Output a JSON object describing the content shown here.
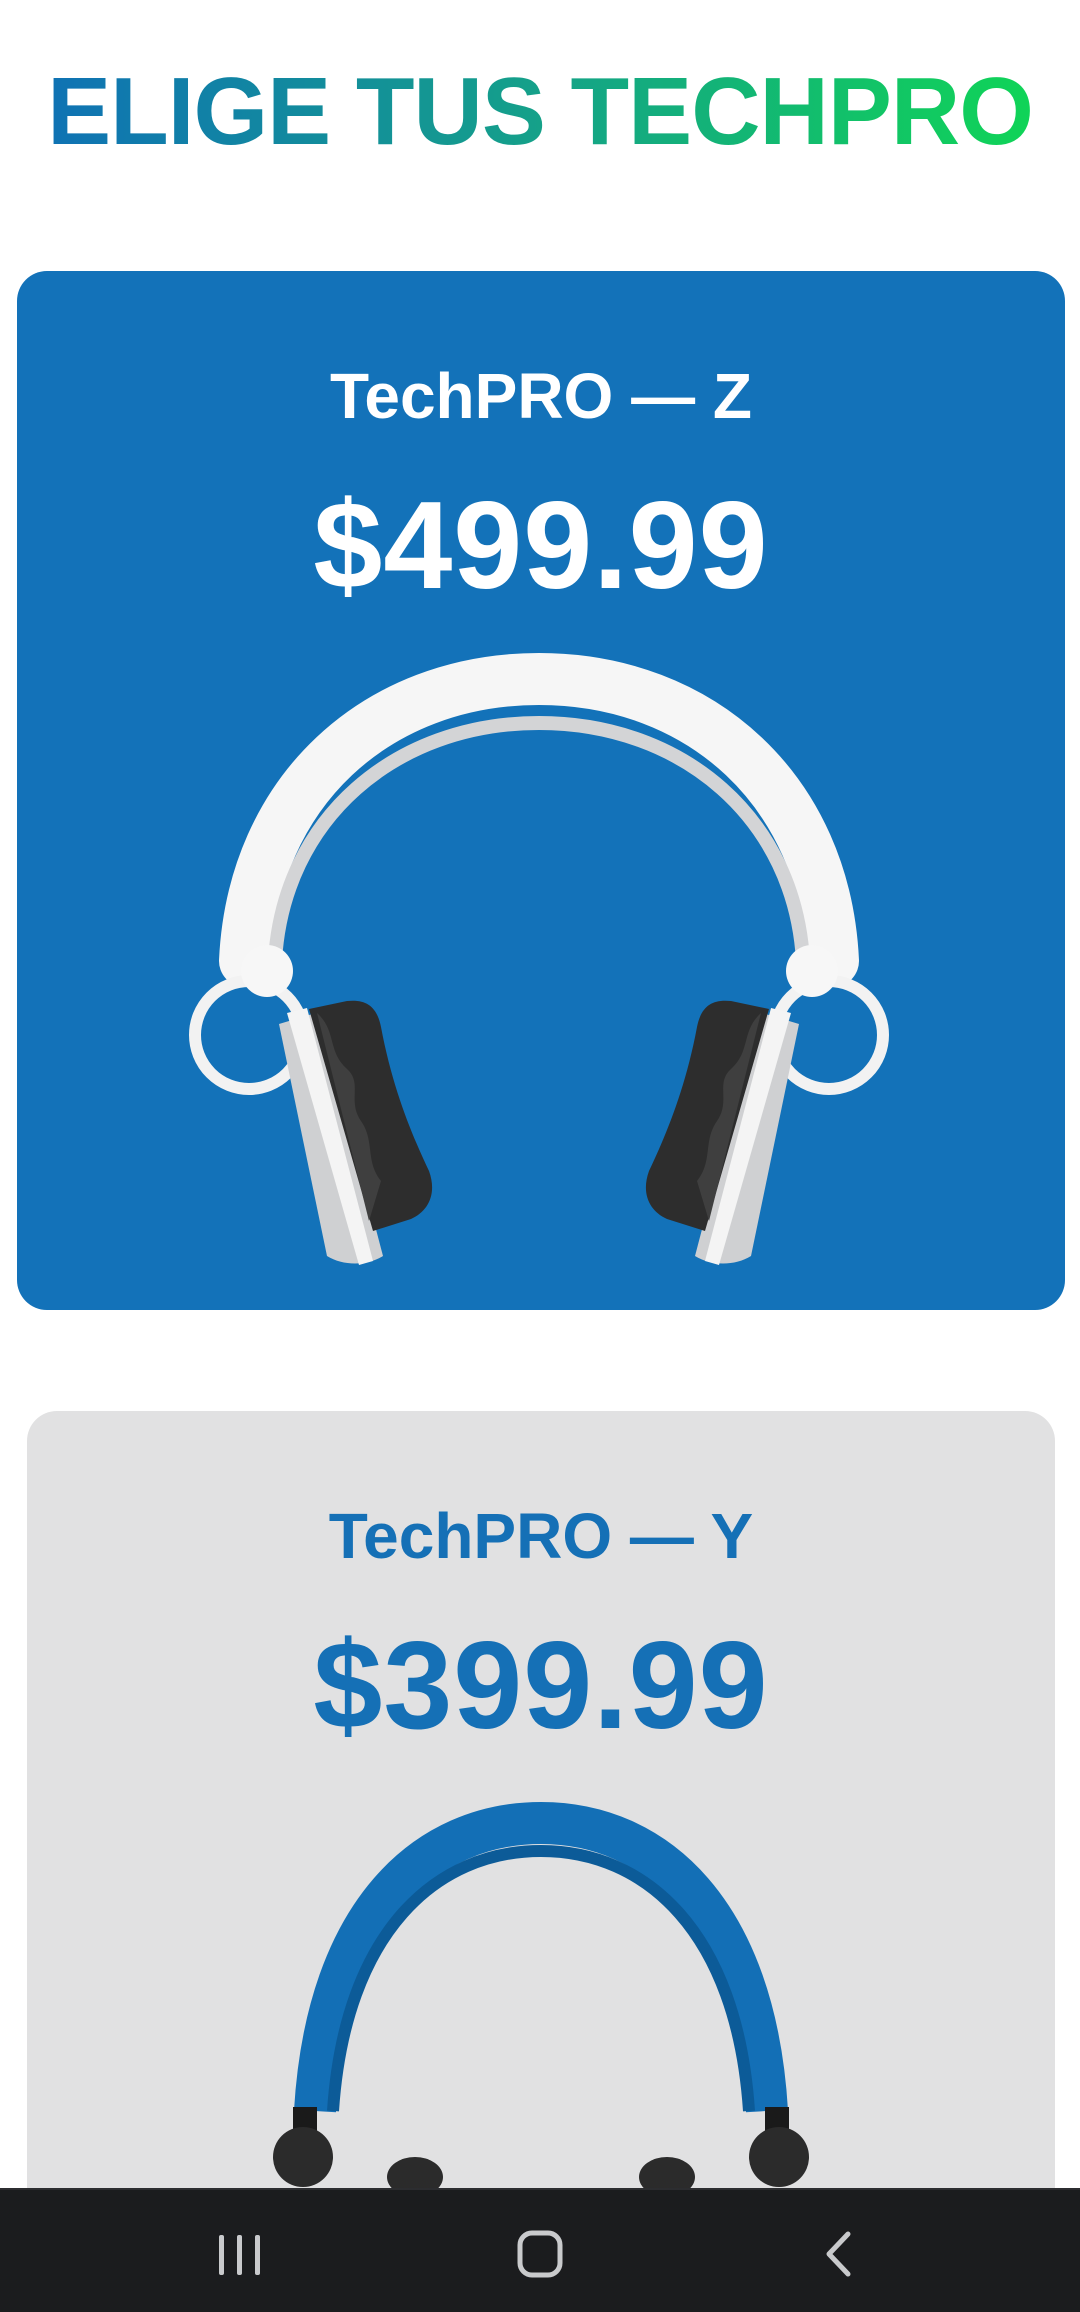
{
  "header": {
    "title": "ELIGE TUS TECHPRO"
  },
  "products": [
    {
      "name": "TechPRO — Z",
      "price": "$499.99",
      "background": "#1372b9",
      "text_color": "#ffffff",
      "image_icon": "headphones-white-icon"
    },
    {
      "name": "TechPRO — Y",
      "price": "$399.99",
      "background": "#e1e1e2",
      "text_color": "#1570b6",
      "image_icon": "headphones-blue-icon"
    }
  ],
  "navbar": {
    "background": "#1b1c1e",
    "buttons": [
      "recents-icon",
      "home-icon",
      "back-icon"
    ]
  },
  "colors": {
    "title_gradient_start": "#0f72b4",
    "title_gradient_end": "#10d457"
  }
}
